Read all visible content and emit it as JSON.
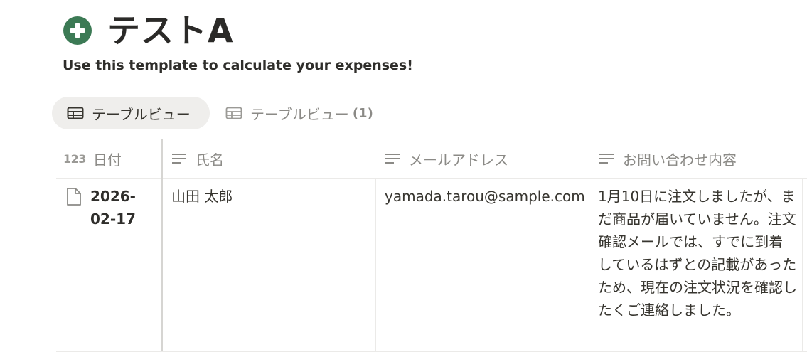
{
  "page": {
    "icon": "plus-circle-icon",
    "icon_color": "#3c7a55",
    "title": "テストA",
    "description": "Use this template to calculate your expenses!"
  },
  "views": [
    {
      "label": "テーブルビュー",
      "icon": "table-icon",
      "active": true
    },
    {
      "label": "テーブルビュー",
      "count": "(1)",
      "icon": "table-icon",
      "active": false
    }
  ],
  "table": {
    "columns": [
      {
        "label": "日付",
        "type_icon": "123"
      },
      {
        "label": "氏名",
        "type_icon": "text-lines-icon"
      },
      {
        "label": "メールアドレス",
        "type_icon": "text-lines-icon"
      },
      {
        "label": "お問い合わせ内容",
        "type_icon": "text-lines-icon"
      }
    ],
    "rows": [
      {
        "row_icon": "document-icon",
        "date": "2026-02-17",
        "name": "山田 太郎",
        "email": "yamada.tarou@sample.com",
        "inquiry": "1月10日に注文しましたが、まだ商品が届いていません。注文確認メールでは、すでに到着しているはずとの記載があったため、現在の注文状況を確認したくご連絡しました。"
      }
    ]
  }
}
